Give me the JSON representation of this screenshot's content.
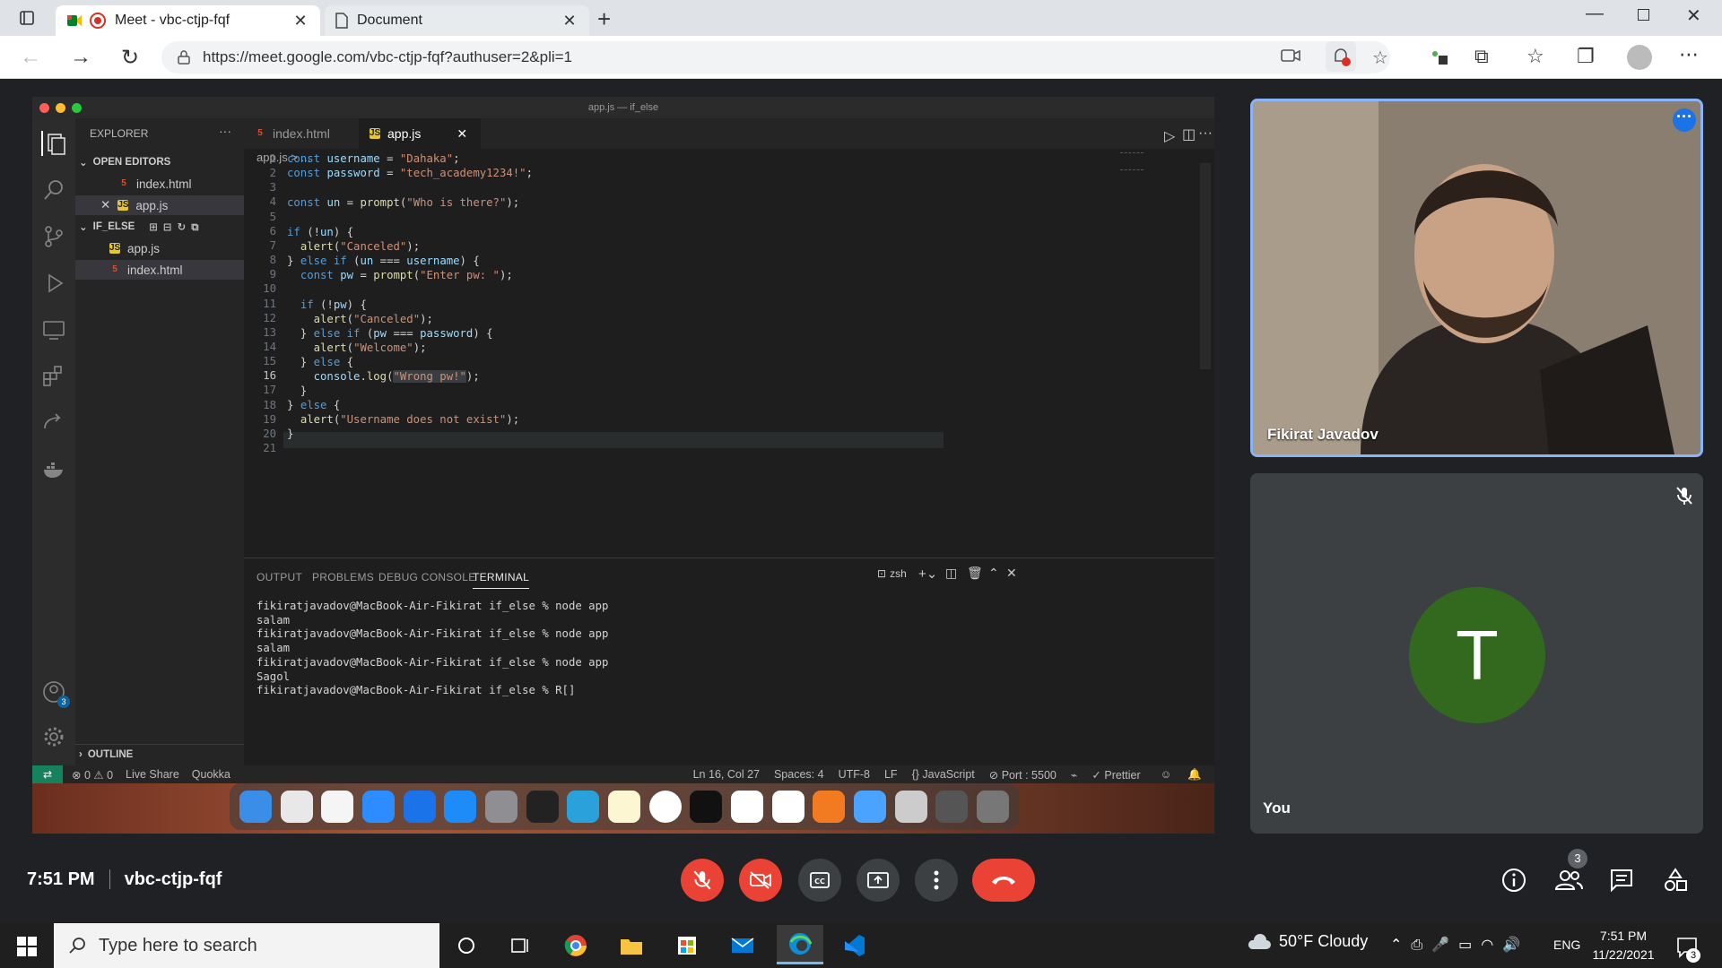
{
  "browser": {
    "tabs": [
      {
        "title": "Meet - vbc-ctjp-fqf"
      },
      {
        "title": "Document"
      }
    ],
    "url": "https://meet.google.com/vbc-ctjp-fqf?authuser=2&pli=1"
  },
  "vscode": {
    "window_title": "app.js — if_else",
    "explorer": {
      "header": "EXPLORER",
      "open_editors_label": "OPEN EDITORS",
      "open_editors": [
        "index.html",
        "app.js"
      ],
      "folder_label": "IF_ELSE",
      "files": [
        "app.js",
        "index.html"
      ],
      "outline_label": "OUTLINE"
    },
    "editor_tabs": [
      "index.html",
      "app.js"
    ],
    "breadcrumb": "app.js > ...",
    "line_numbers": [
      "1",
      "2",
      "3",
      "4",
      "5",
      "6",
      "7",
      "8",
      "9",
      "10",
      "11",
      "12",
      "13",
      "14",
      "15",
      "16",
      "17",
      "18",
      "19",
      "20",
      "21"
    ],
    "panel_tabs": [
      "OUTPUT",
      "PROBLEMS",
      "DEBUG CONSOLE",
      "TERMINAL"
    ],
    "terminal_shell": "zsh",
    "terminal_lines": [
      "fikiratjavadov@MacBook-Air-Fikirat if_else % node app",
      "salam",
      "fikiratjavadov@MacBook-Air-Fikirat if_else % node app",
      "salam",
      "fikiratjavadov@MacBook-Air-Fikirat if_else % node app",
      "Sagol",
      "fikiratjavadov@MacBook-Air-Fikirat if_else % R[]"
    ],
    "status": {
      "errors": "0",
      "warnings": "0",
      "live_share": "Live Share",
      "quokka": "Quokka",
      "position": "Ln 16, Col 27",
      "spaces": "Spaces: 4",
      "encoding": "UTF-8",
      "eol": "LF",
      "language": "JavaScript",
      "port": "Port : 5500",
      "prettier": "Prettier",
      "accounts_badge": "3"
    }
  },
  "meet": {
    "participant_name": "Fikirat Javadov",
    "self_label": "You",
    "self_initial": "T",
    "time": "7:51 PM",
    "meeting_code": "vbc-ctjp-fqf",
    "participants_count": "3"
  },
  "taskbar": {
    "search_placeholder": "Type here to search",
    "weather": "50°F  Cloudy",
    "language": "ENG",
    "time": "7:51 PM",
    "date": "11/22/2021",
    "notifications": "3"
  },
  "colors": {
    "end_call": "#ea4335",
    "mute_red": "#ea4335",
    "avatar_green": "#33691e",
    "tile_border": "#8ab4f8"
  }
}
